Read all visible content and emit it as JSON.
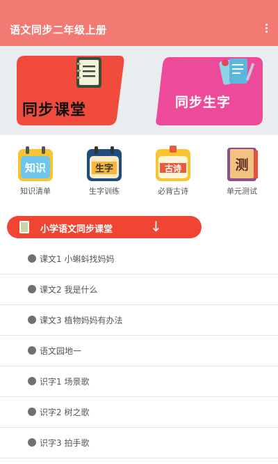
{
  "appbar": {
    "title": "语文同步二年级上册",
    "more_icon": "more-vertical-icon"
  },
  "banner": {
    "left_card": {
      "label": "同步课堂",
      "color": "#f04b3c",
      "icon": "notebook-icon"
    },
    "right_card": {
      "label": "同步生字",
      "color": "#ee4a9a",
      "icon": "cards-icon"
    }
  },
  "grid": [
    {
      "label": "知识清单",
      "icon_text": "知识",
      "icon": "calendar-knowledge-icon"
    },
    {
      "label": "生字训练",
      "icon_text": "生字",
      "icon": "calendar-characters-icon"
    },
    {
      "label": "必背古诗",
      "icon_text": "古诗",
      "icon": "calendar-poem-icon"
    },
    {
      "label": "单元测试",
      "icon_text": "测",
      "icon": "book-test-icon"
    }
  ],
  "section": {
    "title": "小学语文同步课堂",
    "arrow": "↓"
  },
  "list": [
    "课文1 小蝌蚪找妈妈",
    "课文2 我是什么",
    "课文3 植物妈妈有办法",
    "语文园地一",
    "识字1 场景歌",
    "识字2 树之歌",
    "识字3 拍手歌"
  ],
  "colors": {
    "appbar": "#f27a72",
    "section": "#f14534",
    "banner_bg": "#e9edf0"
  }
}
